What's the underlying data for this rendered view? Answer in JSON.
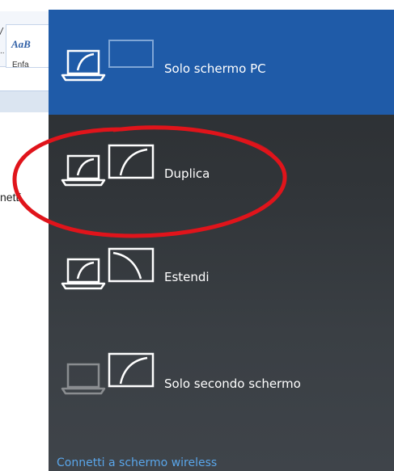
{
  "background_app": {
    "style_sample": "AaB",
    "slash_glyph": "/",
    "style_label": "Enfa",
    "dots": "..",
    "doc_text": "netti"
  },
  "project_flyout": {
    "options": [
      {
        "label": "Solo schermo PC",
        "icon": "pc-screen-only-icon",
        "selected": true
      },
      {
        "label": "Duplica",
        "icon": "duplicate-icon",
        "selected": false
      },
      {
        "label": "Estendi",
        "icon": "extend-icon",
        "selected": false
      },
      {
        "label": "Solo secondo schermo",
        "icon": "second-screen-only-icon",
        "selected": false
      }
    ],
    "wireless_link": "Connetti a schermo wireless"
  },
  "colors": {
    "selected_bg": "#1f5ba8",
    "flyout_bg": "#313539",
    "link": "#5aa6ea",
    "annotation": "#e0141b",
    "dimmed_icon": "#8a8d90"
  }
}
